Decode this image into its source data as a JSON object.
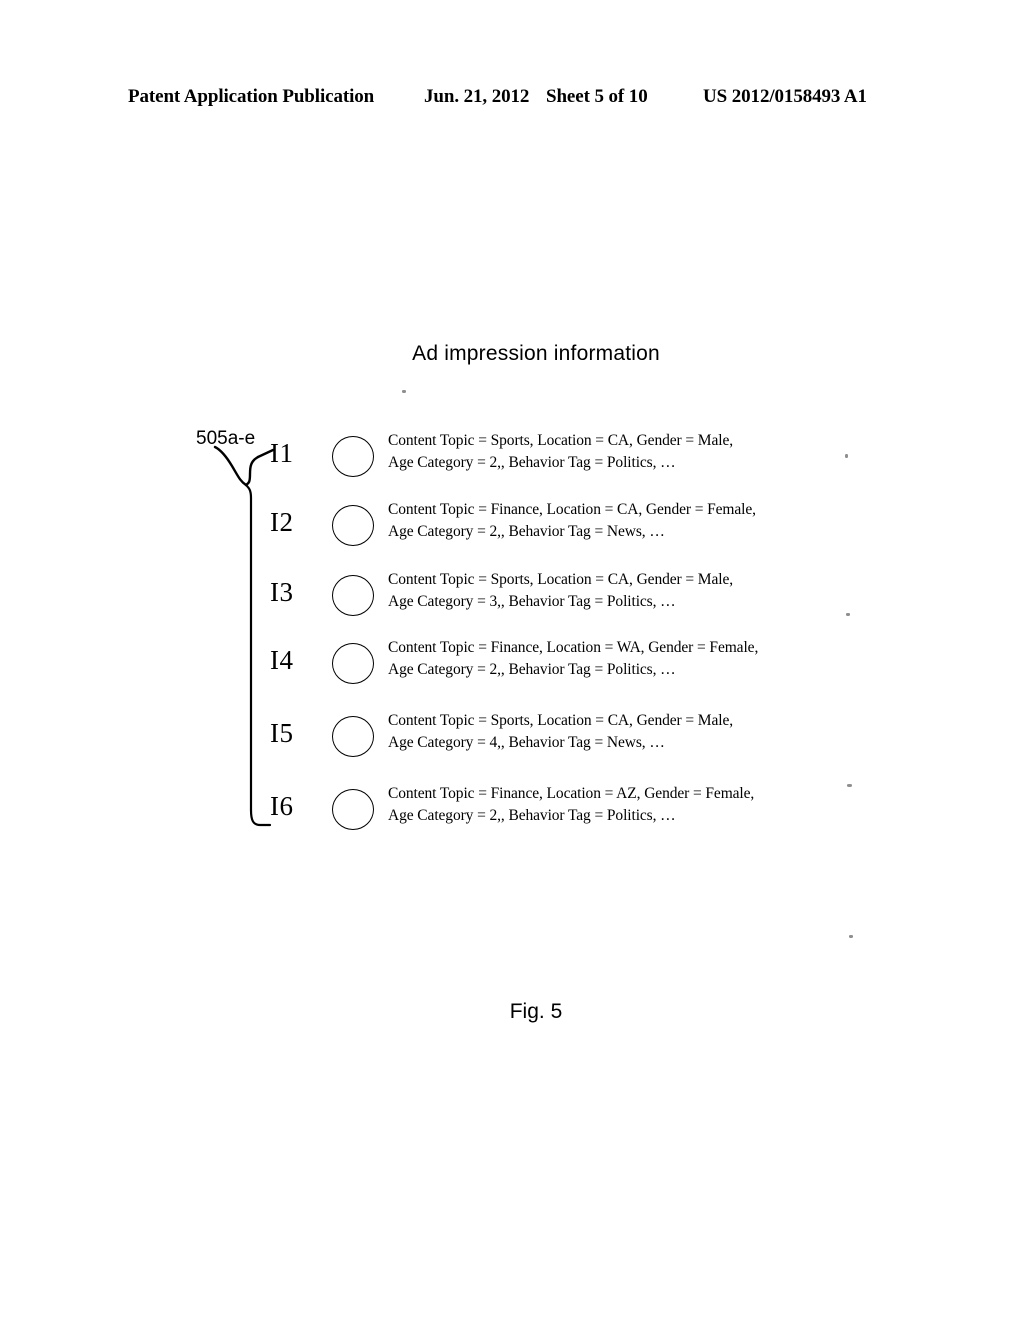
{
  "header": {
    "publication": "Patent Application Publication",
    "date": "Jun. 21, 2012",
    "sheet": "Sheet 5 of 10",
    "patent_number": "US 2012/0158493 A1"
  },
  "figure": {
    "title": "Ad impression information",
    "caption": "Fig. 5",
    "reference_numeral": "505a-e"
  },
  "impressions": [
    {
      "label": "I1",
      "line1": "Content Topic = Sports, Location = CA, Gender = Male,",
      "line2": "Age Category = 2,, Behavior Tag = Politics, …",
      "content_topic": "Sports",
      "location": "CA",
      "gender": "Male",
      "age_category": "2",
      "behavior_tag": "Politics"
    },
    {
      "label": "I2",
      "line1": "Content Topic = Finance, Location = CA, Gender = Female,",
      "line2": "Age Category = 2,, Behavior Tag = News, …",
      "content_topic": "Finance",
      "location": "CA",
      "gender": "Female",
      "age_category": "2",
      "behavior_tag": "News"
    },
    {
      "label": "I3",
      "line1": "Content Topic = Sports, Location = CA, Gender = Male,",
      "line2": "Age Category = 3,, Behavior Tag = Politics, …",
      "content_topic": "Sports",
      "location": "CA",
      "gender": "Male",
      "age_category": "3",
      "behavior_tag": "Politics"
    },
    {
      "label": "I4",
      "line1": "Content Topic = Finance, Location = WA, Gender = Female,",
      "line2": "Age Category = 2,, Behavior Tag = Politics, …",
      "content_topic": "Finance",
      "location": "WA",
      "gender": "Female",
      "age_category": "2",
      "behavior_tag": "Politics"
    },
    {
      "label": "I5",
      "line1": "Content Topic = Sports, Location = CA, Gender = Male,",
      "line2": "Age Category = 4,, Behavior Tag = News, …",
      "content_topic": "Sports",
      "location": "CA",
      "gender": "Male",
      "age_category": "4",
      "behavior_tag": "News"
    },
    {
      "label": "I6",
      "line1": "Content Topic = Finance, Location = AZ, Gender = Female,",
      "line2": "Age Category = 2,, Behavior Tag = Politics, …",
      "content_topic": "Finance",
      "location": "AZ",
      "gender": "Female",
      "age_category": "2",
      "behavior_tag": "Politics"
    }
  ],
  "colors": {
    "ink": "#000000",
    "paper": "#ffffff"
  }
}
